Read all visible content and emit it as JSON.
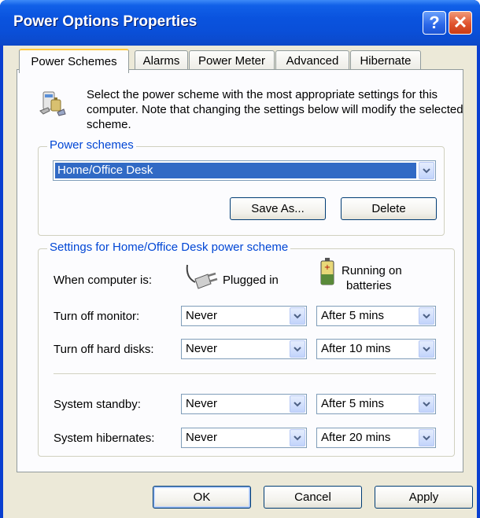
{
  "window": {
    "title": "Power Options Properties",
    "help_label": "?",
    "close_label": "✕"
  },
  "tabs": [
    {
      "label": "Power Schemes",
      "active": true
    },
    {
      "label": "Alarms",
      "active": false
    },
    {
      "label": "Power Meter",
      "active": false
    },
    {
      "label": "Advanced",
      "active": false
    },
    {
      "label": "Hibernate",
      "active": false
    }
  ],
  "description": "Select the power scheme with the most appropriate settings for this computer. Note that changing the settings below will modify the selected scheme.",
  "power_schemes": {
    "group_label": "Power schemes",
    "selected": "Home/Office Desk",
    "save_as_label": "Save As...",
    "delete_label": "Delete"
  },
  "settings": {
    "group_label": "Settings for Home/Office Desk power scheme",
    "when_label": "When computer is:",
    "plugged_label": "Plugged in",
    "batteries_label_1": "Running on",
    "batteries_label_2": "batteries",
    "rows": [
      {
        "label": "Turn off monitor:",
        "plugged": "Never",
        "battery": "After 5 mins"
      },
      {
        "label": "Turn off hard disks:",
        "plugged": "Never",
        "battery": "After 10 mins"
      },
      {
        "label": "System standby:",
        "plugged": "Never",
        "battery": "After 5 mins"
      },
      {
        "label": "System hibernates:",
        "plugged": "Never",
        "battery": "After 20 mins"
      }
    ]
  },
  "footer": {
    "ok_label": "OK",
    "cancel_label": "Cancel",
    "apply_label": "Apply"
  },
  "icons": {
    "scheme": "power-scheme-icon",
    "plug": "power-plug-icon",
    "battery": "battery-icon",
    "dropdown": "chevron-down-icon"
  },
  "colors": {
    "accent": "#0a53de",
    "group_label": "#0046d5",
    "selection": "#316ac5"
  }
}
